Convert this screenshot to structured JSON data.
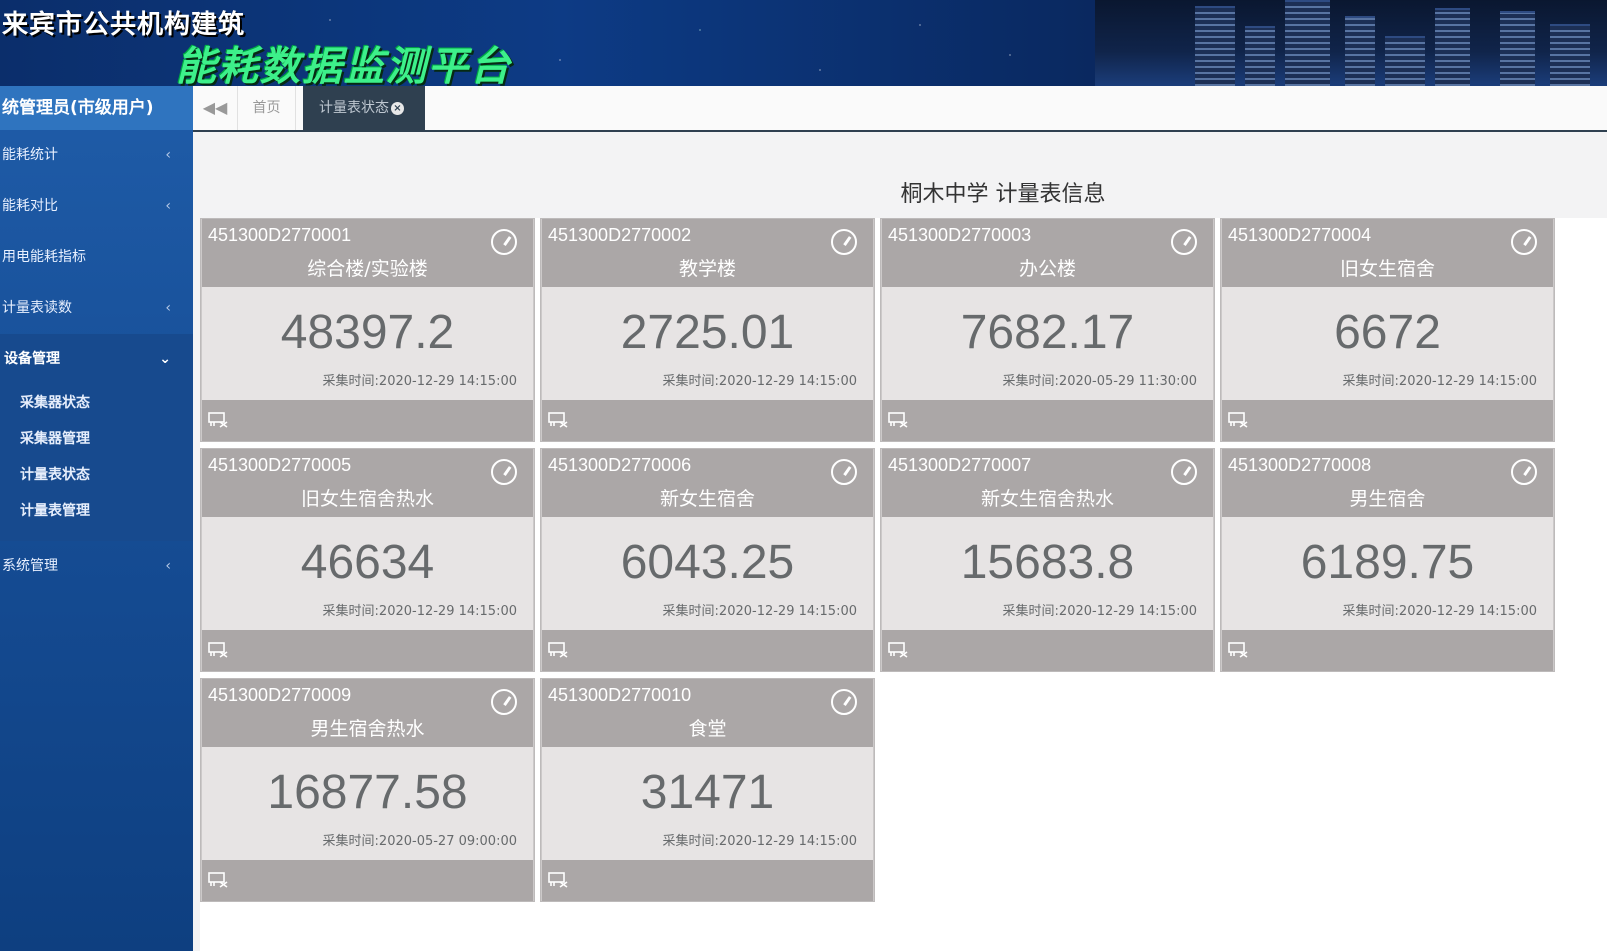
{
  "header": {
    "title": "来宾市公共机构建筑",
    "subtitle": "能耗数据监测平台"
  },
  "sidebar": {
    "user": "统管理员(市级用户)",
    "items": [
      {
        "label": "能耗统计",
        "chevron": "‹"
      },
      {
        "label": "能耗对比",
        "chevron": "‹"
      },
      {
        "label": "用电能耗指标",
        "chevron": ""
      },
      {
        "label": "计量表读数",
        "chevron": "‹"
      },
      {
        "label": "设备管理",
        "chevron": "⌄"
      },
      {
        "label": "系统管理",
        "chevron": "‹"
      }
    ],
    "sub_items": [
      {
        "label": "采集器状态"
      },
      {
        "label": "采集器管理"
      },
      {
        "label": "计量表状态"
      },
      {
        "label": "计量表管理"
      }
    ]
  },
  "tabs": {
    "back_icon": "double-chevron-left-icon",
    "home": "首页",
    "active": "计量表状态",
    "close_glyph": "×"
  },
  "page": {
    "title": "桐木中学 计量表信息"
  },
  "meters": [
    {
      "id": "451300D2770001",
      "name": "综合楼/实验楼",
      "value": "48397.2",
      "time": "采集时间:2020-12-29 14:15:00"
    },
    {
      "id": "451300D2770002",
      "name": "教学楼",
      "value": "2725.01",
      "time": "采集时间:2020-12-29 14:15:00"
    },
    {
      "id": "451300D2770003",
      "name": "办公楼",
      "value": "7682.17",
      "time": "采集时间:2020-05-29 11:30:00"
    },
    {
      "id": "451300D2770004",
      "name": "旧女生宿舍",
      "value": "6672",
      "time": "采集时间:2020-12-29 14:15:00"
    },
    {
      "id": "451300D2770005",
      "name": "旧女生宿舍热水",
      "value": "46634",
      "time": "采集时间:2020-12-29 14:15:00"
    },
    {
      "id": "451300D2770006",
      "name": "新女生宿舍",
      "value": "6043.25",
      "time": "采集时间:2020-12-29 14:15:00"
    },
    {
      "id": "451300D2770007",
      "name": "新女生宿舍热水",
      "value": "15683.8",
      "time": "采集时间:2020-12-29 14:15:00"
    },
    {
      "id": "451300D2770008",
      "name": "男生宿舍",
      "value": "6189.75",
      "time": "采集时间:2020-12-29 14:15:00"
    },
    {
      "id": "451300D2770009",
      "name": "男生宿舍热水",
      "value": "16877.58",
      "time": "采集时间:2020-05-27 09:00:00"
    },
    {
      "id": "451300D2770010",
      "name": "食堂",
      "value": "31471",
      "time": "采集时间:2020-12-29 14:15:00"
    }
  ],
  "colors": {
    "sidebar": "#1f5ca8",
    "tab_active": "#2f4050",
    "card_head": "#aba7a7",
    "card_body": "#e7e4e4"
  }
}
